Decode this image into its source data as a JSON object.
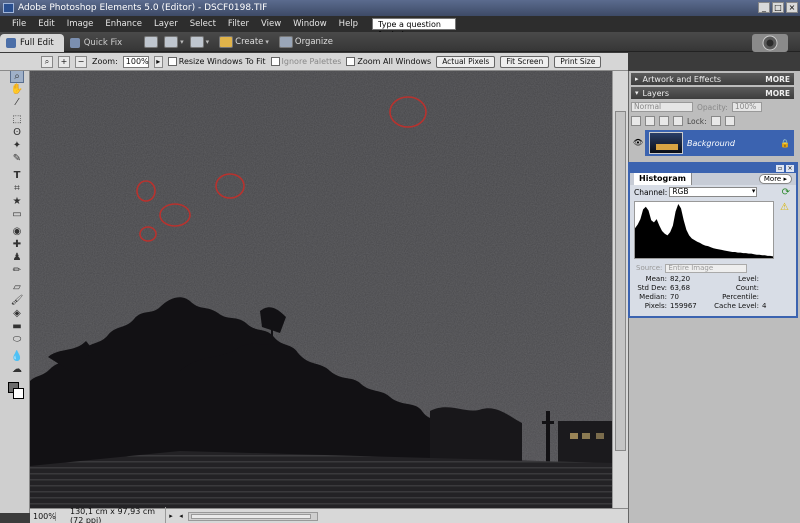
{
  "window": {
    "title": "Adobe Photoshop Elements 5.0 (Editor) - DSCF0198.TIF",
    "buttons": [
      "_",
      "□",
      "×"
    ]
  },
  "menu": {
    "items": [
      "File",
      "Edit",
      "Image",
      "Enhance",
      "Layer",
      "Select",
      "Filter",
      "View",
      "Window",
      "Help"
    ],
    "help_placeholder": "Type a question for help"
  },
  "modebar": {
    "tabs": [
      {
        "label": "Full Edit",
        "active": true
      },
      {
        "label": "Quick Fix",
        "active": false
      }
    ],
    "create_label": "Create",
    "organize_label": "Organize"
  },
  "options": {
    "zoom_label": "Zoom:",
    "zoom_value": "100%",
    "resize_windows": "Resize Windows To Fit",
    "ignore_palettes": "Ignore Palettes",
    "zoom_all_windows": "Zoom All Windows",
    "actual_pixels": "Actual Pixels",
    "fit_screen": "Fit Screen",
    "print_size": "Print Size"
  },
  "tools": [
    "move-tool",
    "zoom-tool",
    "hand-tool",
    "eyedropper-tool",
    "marquee-tool",
    "lasso-tool",
    "magic-wand-tool",
    "selection-brush-tool",
    "type-tool",
    "crop-tool",
    "cookie-cutter-tool",
    "straighten-tool",
    "red-eye-tool",
    "spot-healing-tool",
    "clone-stamp-tool",
    "pencil-tool",
    "eraser-tool",
    "brush-tool",
    "paint-bucket-tool",
    "gradient-tool",
    "shape-tool",
    "blur-tool",
    "sponge-tool"
  ],
  "status": {
    "zoom": "100%",
    "info": "130,1 cm x 97,93 cm (72 ppi)"
  },
  "palette": {
    "artwork_title": "Artwork and Effects",
    "layers_title": "Layers",
    "more_label": "MORE",
    "blend_mode": "Normal",
    "opacity_label": "Opacity:",
    "opacity_value": "100%",
    "lock_label": "Lock:",
    "layer_name": "Background"
  },
  "histogram": {
    "tab_label": "Histogram",
    "more_label": "More",
    "channel_label": "Channel:",
    "channel_value": "RGB",
    "source_label": "Source:",
    "source_value": "Entire Image",
    "stats_left": [
      {
        "label": "Mean:",
        "value": "82,20"
      },
      {
        "label": "Std Dev:",
        "value": "63,68"
      },
      {
        "label": "Median:",
        "value": "70"
      },
      {
        "label": "Pixels:",
        "value": "159967"
      }
    ],
    "stats_right": [
      {
        "label": "Level:",
        "value": ""
      },
      {
        "label": "Count:",
        "value": ""
      },
      {
        "label": "Percentile:",
        "value": ""
      },
      {
        "label": "Cache Level:",
        "value": "4"
      }
    ],
    "profile": [
      0.55,
      0.62,
      0.72,
      0.9,
      0.95,
      0.88,
      0.7,
      0.66,
      0.72,
      0.6,
      0.5,
      0.45,
      0.42,
      0.48,
      0.6,
      0.86,
      1.0,
      0.92,
      0.7,
      0.52,
      0.42,
      0.36,
      0.33,
      0.3,
      0.28,
      0.25,
      0.23,
      0.22,
      0.2,
      0.18,
      0.17,
      0.16,
      0.15,
      0.14,
      0.13,
      0.12,
      0.11,
      0.11,
      0.1,
      0.1,
      0.09,
      0.09,
      0.08,
      0.08,
      0.07,
      0.06,
      0.06,
      0.05,
      0.05,
      0.04,
      0.04,
      0.03
    ]
  },
  "colors": {
    "accent": "#3b63b0",
    "annotation": "#b8322e",
    "sky": "#47474a"
  }
}
